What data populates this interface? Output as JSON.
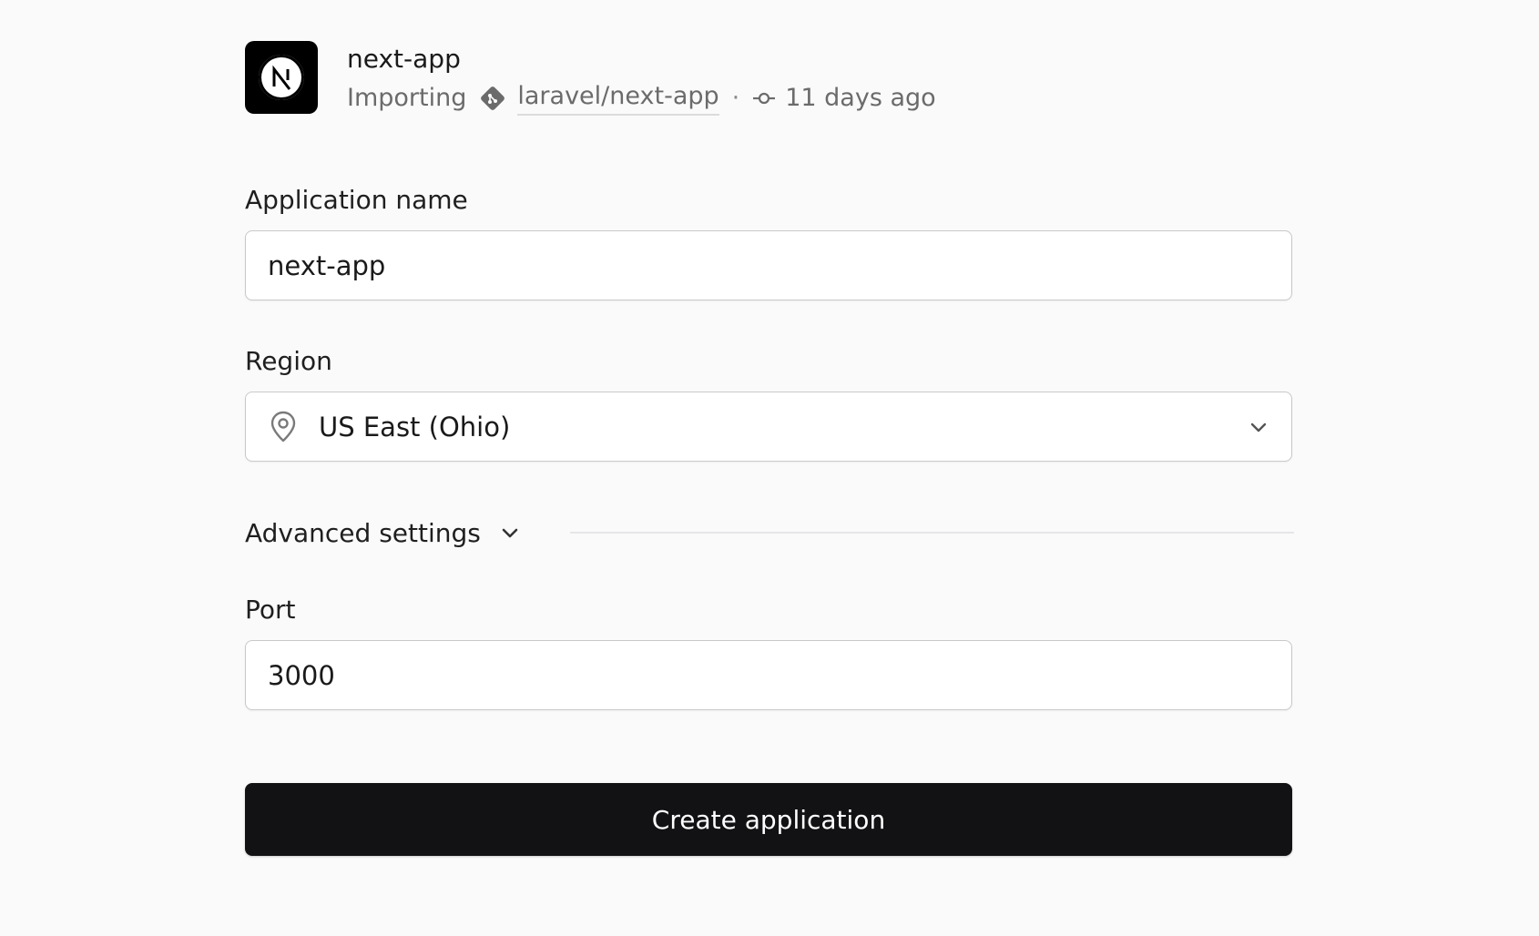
{
  "project": {
    "name": "next-app",
    "status": "Importing",
    "repo": "laravel/next-app",
    "separator": "·",
    "commit_age": "11 days ago",
    "logo_icon": "nextjs-logo-icon"
  },
  "form": {
    "app_name": {
      "label": "Application name",
      "value": "next-app"
    },
    "region": {
      "label": "Region",
      "value": "US East (Ohio)",
      "icon": "map-pin-icon"
    },
    "advanced": {
      "label": "Advanced settings"
    },
    "port": {
      "label": "Port",
      "value": "3000"
    },
    "submit_label": "Create application"
  },
  "colors": {
    "background": "#fafafb",
    "button": "#121214",
    "muted_text": "#6b6b6b"
  }
}
